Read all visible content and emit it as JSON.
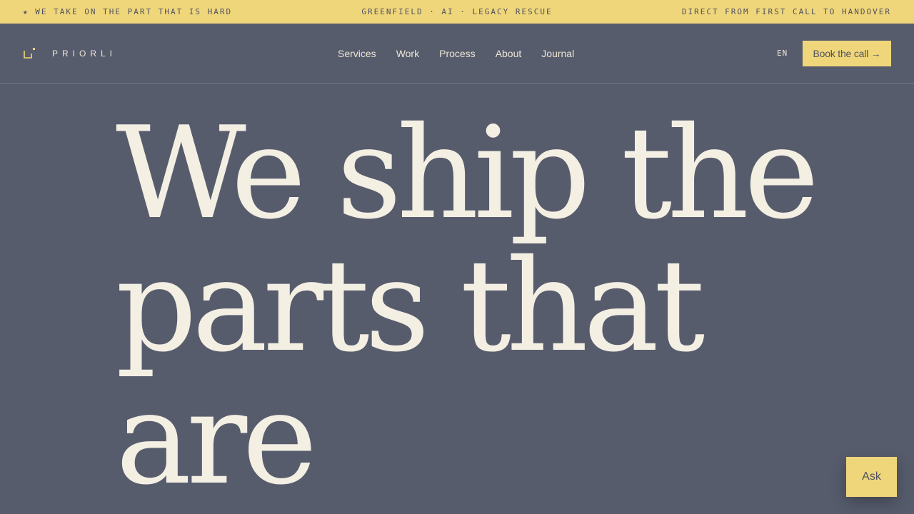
{
  "announcement": {
    "left": "★ WE TAKE ON THE PART THAT IS HARD",
    "center": "GREENFIELD · AI · LEGACY RESCUE",
    "right": "DIRECT FROM FIRST CALL TO HANDOVER"
  },
  "brand": {
    "name": "PRIORLI",
    "icon": "logo-bracket-icon"
  },
  "nav": {
    "items": [
      {
        "label": "Services"
      },
      {
        "label": "Work"
      },
      {
        "label": "Process"
      },
      {
        "label": "About"
      },
      {
        "label": "Journal"
      }
    ],
    "language": "EN",
    "cta_label": "Book the call →"
  },
  "hero": {
    "headline": "We ship the parts that are"
  },
  "chat": {
    "ask_label": "Ask"
  },
  "colors": {
    "background": "#575c6d",
    "accent": "#f0d67a",
    "text_light": "#f4efe3",
    "text_dark": "#4f5260"
  }
}
